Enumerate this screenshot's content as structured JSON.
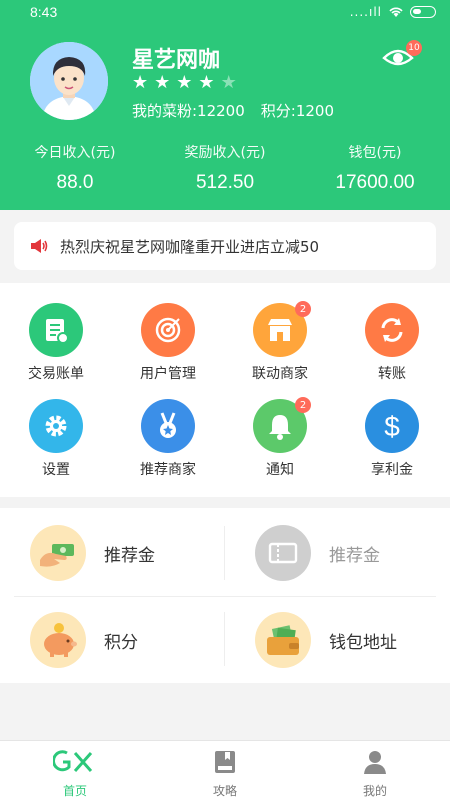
{
  "status": {
    "time": "8:43",
    "signal": "....ıll"
  },
  "profile": {
    "name": "星艺网咖",
    "rating": 4,
    "max_rating": 5,
    "fans_label": "我的菜粉:12200",
    "points_label": "积分:1200",
    "eye_badge": "10"
  },
  "income": [
    {
      "label": "今日收入(元)",
      "value": "88.0"
    },
    {
      "label": "奖励收入(元)",
      "value": "512.50"
    },
    {
      "label": "钱包(元)",
      "value": "17600.00"
    }
  ],
  "notice": {
    "text": "热烈庆祝星艺网咖隆重开业进店立减50"
  },
  "grid": [
    {
      "label": "交易账单",
      "icon": "bill-icon",
      "color": "#2cc87a",
      "badge": ""
    },
    {
      "label": "用户管理",
      "icon": "target-icon",
      "color": "#ff7a45",
      "badge": ""
    },
    {
      "label": "联动商家",
      "icon": "shop-icon",
      "color": "#ffa53b",
      "badge": "2"
    },
    {
      "label": "转账",
      "icon": "transfer-icon",
      "color": "#ff7a45",
      "badge": ""
    },
    {
      "label": "设置",
      "icon": "gear-icon",
      "color": "#33b6ea",
      "badge": ""
    },
    {
      "label": "推荐商家",
      "icon": "medal-icon",
      "color": "#3b8fe8",
      "badge": ""
    },
    {
      "label": "通知",
      "icon": "bell-icon",
      "color": "#2cc87a",
      "badge": "2"
    },
    {
      "label": "享利金",
      "icon": "dollar-icon",
      "color": "#2a8fe0",
      "badge": ""
    }
  ],
  "panel": [
    {
      "label": "推荐金",
      "icon": "money-hand-icon",
      "dim": false
    },
    {
      "label": "推荐金",
      "icon": "ticket-icon",
      "dim": true
    },
    {
      "label": "积分",
      "icon": "piggy-bank-icon",
      "dim": false
    },
    {
      "label": "钱包地址",
      "icon": "wallet-icon",
      "dim": false
    }
  ],
  "tabs": [
    {
      "label": "首页",
      "icon": "home-logo-icon",
      "active": true
    },
    {
      "label": "攻略",
      "icon": "book-icon",
      "active": false
    },
    {
      "label": "我的",
      "icon": "person-icon",
      "active": false
    }
  ]
}
